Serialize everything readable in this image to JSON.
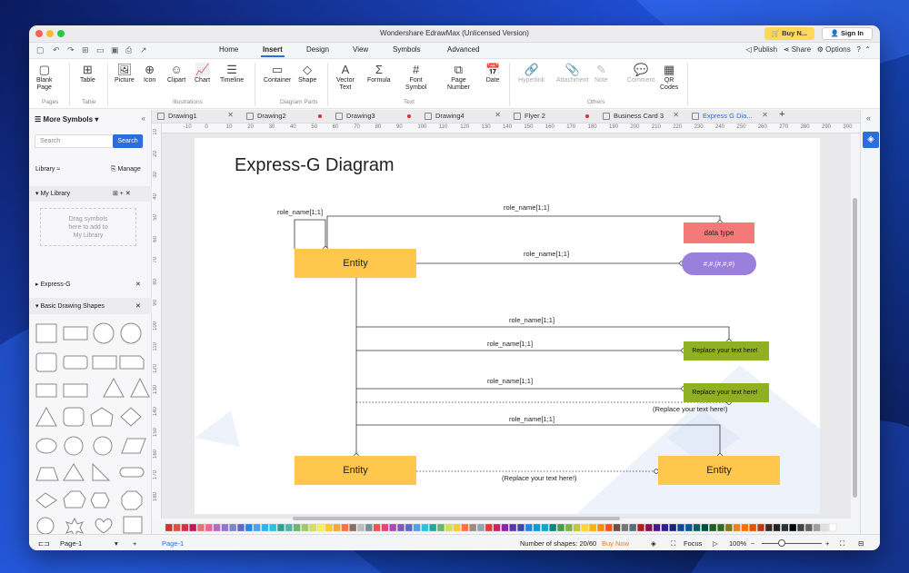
{
  "window": {
    "title": "Wondershare EdrawMax (Unlicensed Version)",
    "buy_label": "Buy N...",
    "sign_in_label": "Sign In"
  },
  "menu": {
    "tabs": [
      "Home",
      "Insert",
      "Design",
      "View",
      "Symbols",
      "Advanced"
    ],
    "active": "Insert",
    "publish": "Publish",
    "share": "Share",
    "options": "Options"
  },
  "ribbon": {
    "buttons": [
      {
        "label": "Blank\nPage",
        "icon": "page-icon"
      },
      {
        "label": "Table",
        "icon": "table-icon"
      },
      {
        "label": "Picture",
        "icon": "picture-icon"
      },
      {
        "label": "Icon",
        "icon": "icon-icon"
      },
      {
        "label": "Clipart",
        "icon": "clipart-icon"
      },
      {
        "label": "Chart",
        "icon": "chart-icon"
      },
      {
        "label": "Timeline",
        "icon": "timeline-icon"
      },
      {
        "label": "Container",
        "icon": "container-icon"
      },
      {
        "label": "Shape",
        "icon": "shape-icon"
      },
      {
        "label": "Vector\nText",
        "icon": "vector-text-icon"
      },
      {
        "label": "Formula",
        "icon": "formula-icon"
      },
      {
        "label": "Font\nSymbol",
        "icon": "font-symbol-icon"
      },
      {
        "label": "Page\nNumber",
        "icon": "page-number-icon"
      },
      {
        "label": "Date",
        "icon": "date-icon"
      },
      {
        "label": "Hyperlink",
        "icon": "hyperlink-icon"
      },
      {
        "label": "Attachment",
        "icon": "attachment-icon"
      },
      {
        "label": "Note",
        "icon": "note-icon"
      },
      {
        "label": "Comment",
        "icon": "comment-icon"
      },
      {
        "label": "QR\nCodes",
        "icon": "qr-icon"
      }
    ],
    "groups": [
      "Pages",
      "Table",
      "Illustrations",
      "Diagram Parts",
      "Text",
      "Others"
    ]
  },
  "left_panel": {
    "title": "More Symbols",
    "search_placeholder": "Search",
    "search_button": "Search",
    "library_label": "Library",
    "manage_label": "Manage",
    "my_library": "My Library",
    "drag_hint": "Drag symbols\nhere to add to\nMy Library",
    "sections": [
      "Express-G",
      "Basic Drawing Shapes"
    ]
  },
  "doc_tabs": [
    {
      "name": "Drawing1",
      "state": "close"
    },
    {
      "name": "Drawing2",
      "state": "dot"
    },
    {
      "name": "Drawing3",
      "state": "dot"
    },
    {
      "name": "Drawing4",
      "state": "close"
    },
    {
      "name": "Flyer 2",
      "state": "dot"
    },
    {
      "name": "Business Card 3",
      "state": "close"
    },
    {
      "name": "Express G Dia...",
      "state": "close",
      "active": true
    }
  ],
  "ruler": {
    "top": [
      "-10",
      "0",
      "10",
      "20",
      "30",
      "40",
      "50",
      "60",
      "70",
      "80",
      "90",
      "100",
      "110",
      "120",
      "130",
      "140",
      "150",
      "160",
      "170",
      "180",
      "190",
      "200",
      "210",
      "220",
      "230",
      "240",
      "250",
      "260",
      "270",
      "280",
      "290",
      "300"
    ],
    "left": [
      "10",
      "20",
      "30",
      "40",
      "50",
      "60",
      "70",
      "80",
      "90",
      "100",
      "110",
      "120",
      "130",
      "140",
      "150",
      "160",
      "170",
      "180"
    ]
  },
  "diagram": {
    "title": "Express-G  Diagram",
    "entity": "Entity",
    "data_type": "data type",
    "enum_text": "#,#,(#,#,#)",
    "role": "role_name[1;1]",
    "replace": "Replace your text here!",
    "replace_paren": "(Replace your text here!)"
  },
  "status": {
    "page_tab": "Page-1",
    "page_label": "Page-1",
    "shapes": "Number of shapes: 20/60",
    "buy_now": "Buy Now",
    "focus": "Focus",
    "zoom": "100%"
  },
  "colors": {
    "accent": "#2d6cdf",
    "entity": "#ffc84d",
    "datatype": "#f47a7a",
    "enum": "#9b7fdc",
    "green": "#8eb021"
  },
  "palette": [
    "#c0392b",
    "#e74c3c",
    "#d6304a",
    "#c2185b",
    "#e57373",
    "#f06292",
    "#ba68c8",
    "#9575cd",
    "#7986cb",
    "#5c6bc0",
    "#1e88e5",
    "#42a5f5",
    "#29b6f6",
    "#26c6da",
    "#26a69a",
    "#4db6ac",
    "#66bb6a",
    "#9ccc65",
    "#d4e157",
    "#ffee58",
    "#ffca28",
    "#ffa726",
    "#ff7043",
    "#8d6e63",
    "#bdbdbd",
    "#78909c",
    "#ef5350",
    "#ec407a",
    "#ab47bc",
    "#7e57c2",
    "#5c6bc0",
    "#42a5f5",
    "#26c6da",
    "#26a69a",
    "#66bb6a",
    "#d4e157",
    "#ffca28",
    "#ff7043",
    "#a1887f",
    "#90a4ae",
    "#e53935",
    "#d81b60",
    "#8e24aa",
    "#5e35b1",
    "#3949ab",
    "#1e88e5",
    "#039be5",
    "#00acc1",
    "#00897b",
    "#43a047",
    "#7cb342",
    "#c0ca33",
    "#fdd835",
    "#ffb300",
    "#fb8c00",
    "#f4511e",
    "#6d4c41",
    "#757575",
    "#546e7a",
    "#b71c1c",
    "#880e4f",
    "#4a148c",
    "#311b92",
    "#1a237e",
    "#0d47a1",
    "#01579b",
    "#006064",
    "#004d40",
    "#1b5e20",
    "#33691e",
    "#827717",
    "#f57f17",
    "#ff6f00",
    "#e65100",
    "#bf360c",
    "#3e2723",
    "#212121",
    "#263238",
    "#000000",
    "#424242",
    "#616161",
    "#9e9e9e",
    "#e0e0e0",
    "#ffffff"
  ]
}
